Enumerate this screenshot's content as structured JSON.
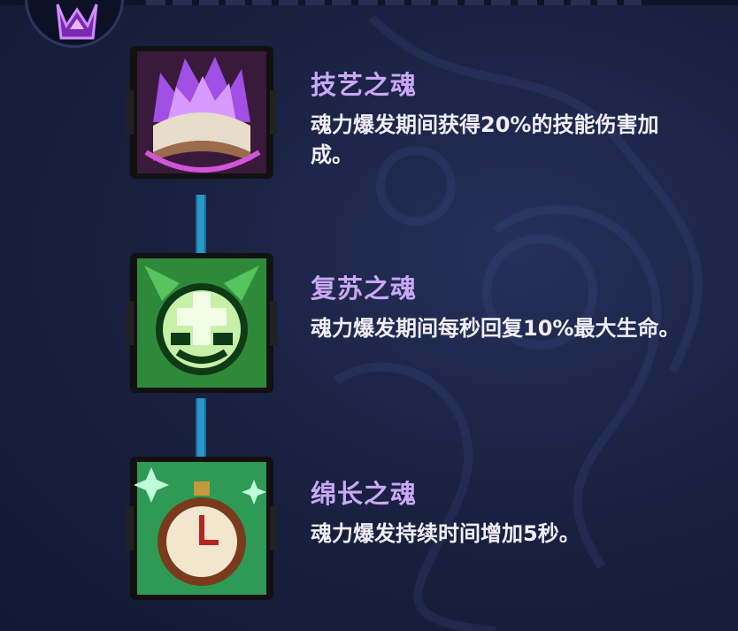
{
  "skills": [
    {
      "name": "技艺之魂",
      "desc": "魂力爆发期间获得20%的技能伤害加成。",
      "icon": "purple-flame-book-icon",
      "color": "#8e3fd6"
    },
    {
      "name": "复苏之魂",
      "desc": "魂力爆发期间每秒回复10%最大生命。",
      "icon": "green-heal-cross-icon",
      "color": "#2e8f3c"
    },
    {
      "name": "绵长之魂",
      "desc": "魂力爆发持续时间增加5秒。",
      "icon": "stopwatch-icon",
      "color": "#2e8f3c"
    }
  ],
  "colors": {
    "name_text": "#c9a8f4",
    "desc_text": "#f0eef8",
    "connector": "#2a95c9",
    "background": "#1a2142"
  }
}
